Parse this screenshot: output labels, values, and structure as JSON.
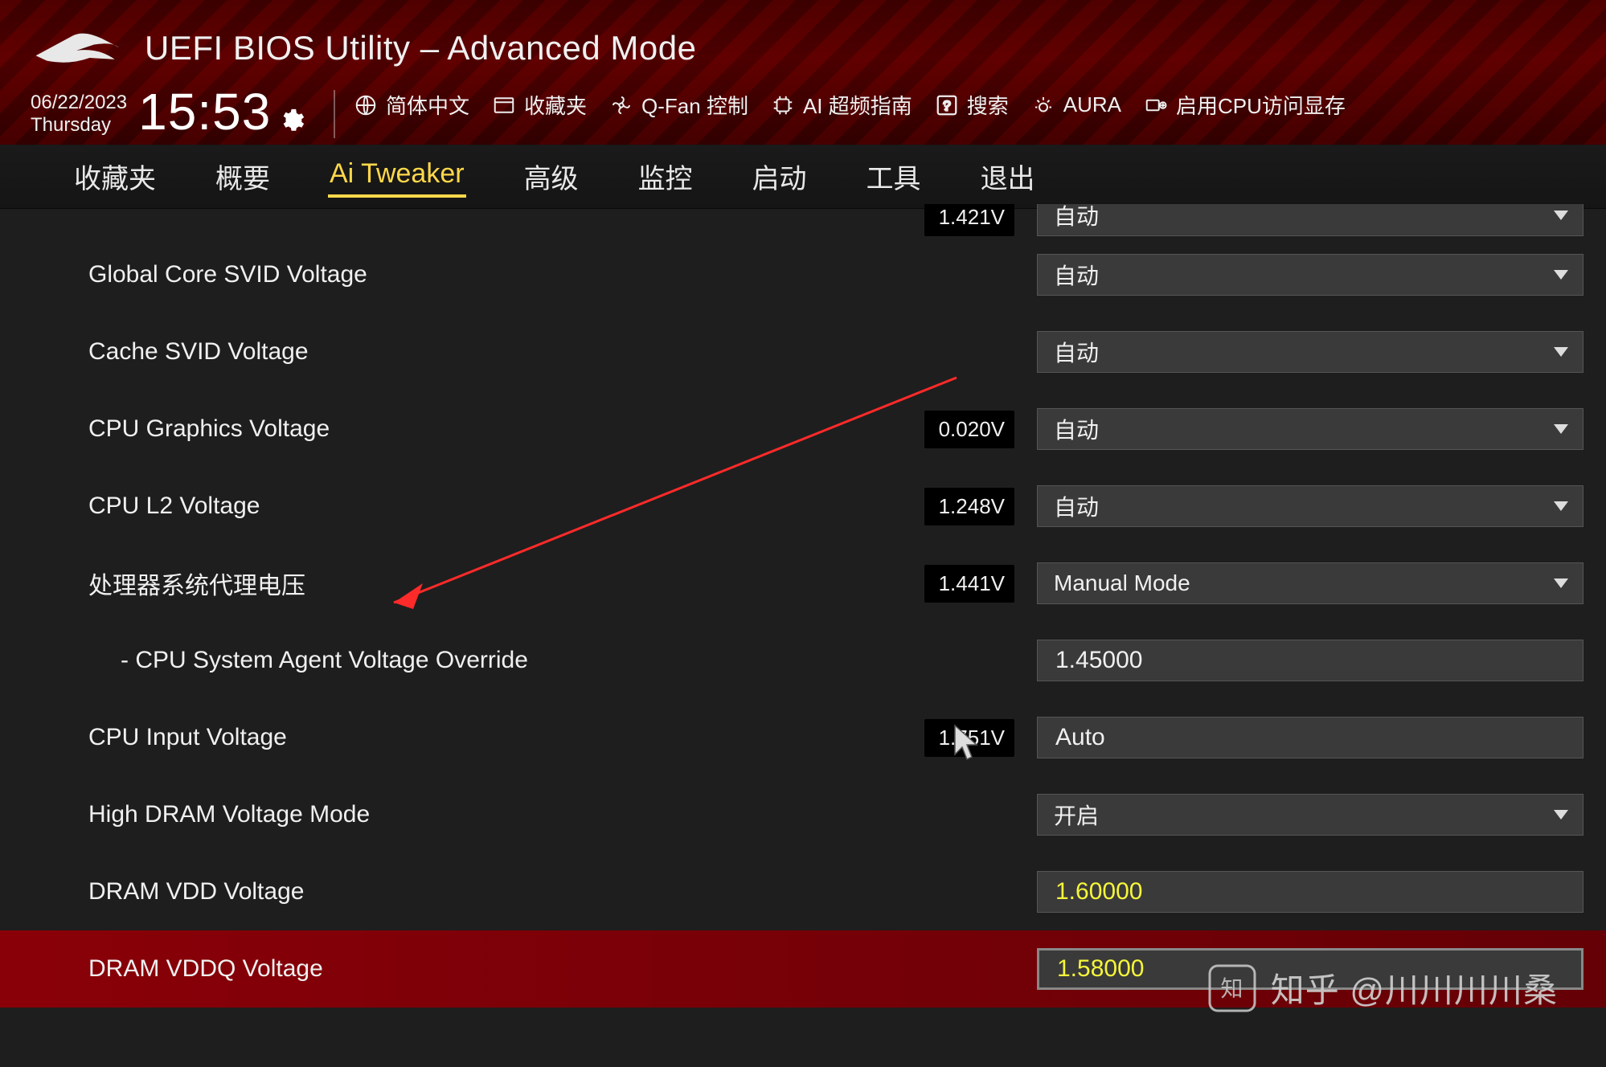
{
  "header": {
    "title": "UEFI BIOS Utility – Advanced Mode",
    "date": "06/22/2023",
    "day_of_week": "Thursday",
    "time": "15:53"
  },
  "top_actions": {
    "language": "简体中文",
    "favorites": "收藏夹",
    "qfan": "Q-Fan 控制",
    "ai_oc": "AI 超频指南",
    "search": "搜索",
    "aura": "AURA",
    "resize_bar": "启用CPU访问显存"
  },
  "tabs": [
    "收藏夹",
    "概要",
    "Ai Tweaker",
    "高级",
    "监控",
    "启动",
    "工具",
    "退出"
  ],
  "active_tab_index": 2,
  "rows": [
    {
      "label_cut": "",
      "readout": "1.421V",
      "control_type": "dropdown",
      "control_text": "自动"
    },
    {
      "label": "Global Core SVID Voltage",
      "readout": "",
      "control_type": "dropdown",
      "control_text": "自动"
    },
    {
      "label": "Cache SVID Voltage",
      "readout": "",
      "control_type": "dropdown",
      "control_text": "自动"
    },
    {
      "label": "CPU Graphics Voltage",
      "readout": "0.020V",
      "control_type": "dropdown",
      "control_text": "自动"
    },
    {
      "label": "CPU L2 Voltage",
      "readout": "1.248V",
      "control_type": "dropdown",
      "control_text": "自动"
    },
    {
      "label": "处理器系统代理电压",
      "readout": "1.441V",
      "control_type": "dropdown",
      "control_text": "Manual Mode"
    },
    {
      "label": "- CPU System Agent Voltage Override",
      "readout": "",
      "control_type": "text",
      "control_text": "1.45000",
      "indent": true
    },
    {
      "label": "CPU Input Voltage",
      "readout": "1.751V",
      "control_type": "text",
      "control_text": "Auto"
    },
    {
      "label": "High DRAM Voltage Mode",
      "readout": "",
      "control_type": "dropdown",
      "control_text": "开启"
    },
    {
      "label": "DRAM VDD Voltage",
      "readout": "",
      "control_type": "text",
      "control_text": "1.60000",
      "yellow": true
    },
    {
      "label": "DRAM VDDQ Voltage",
      "readout": "",
      "control_type": "text",
      "control_text": "1.58000",
      "yellow": true,
      "selected": true
    }
  ],
  "watermark": "知乎 @川川川川桑"
}
